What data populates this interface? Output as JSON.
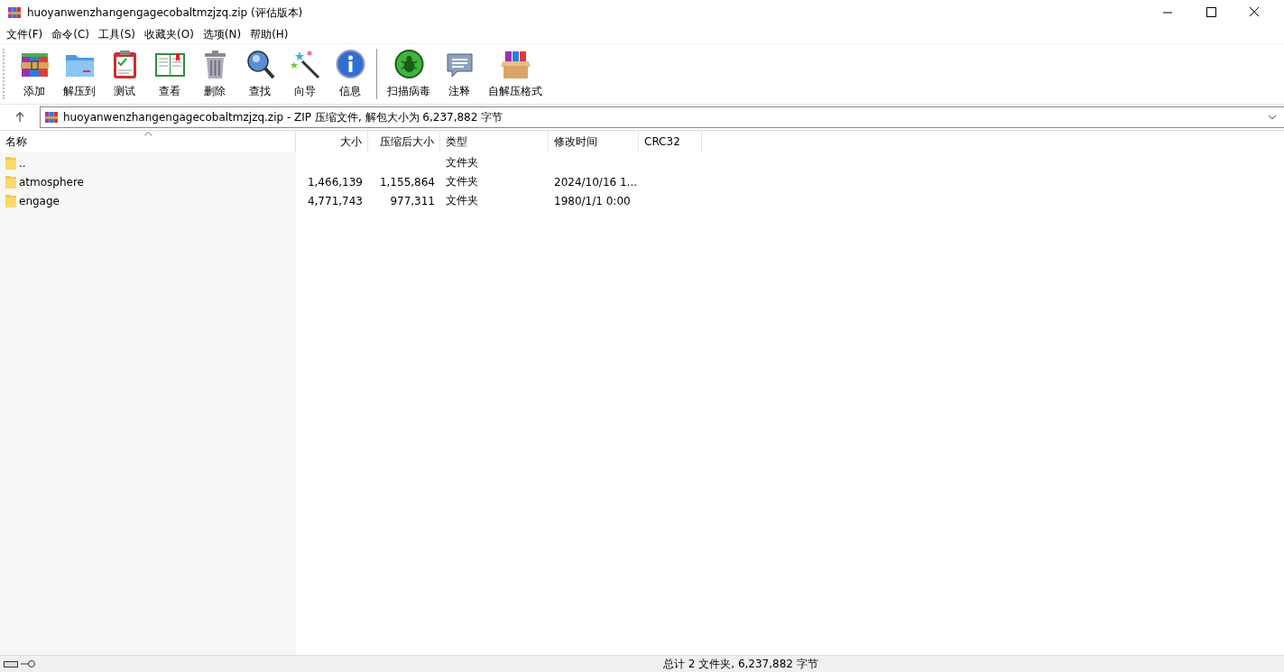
{
  "window": {
    "title": "huoyanwenzhangengagecobaltmzjzq.zip (评估版本)"
  },
  "menu": [
    "文件(F)",
    "命令(C)",
    "工具(S)",
    "收藏夹(O)",
    "选项(N)",
    "帮助(H)"
  ],
  "toolbar": [
    {
      "label": "添加"
    },
    {
      "label": "解压到"
    },
    {
      "label": "测试"
    },
    {
      "label": "查看"
    },
    {
      "label": "删除"
    },
    {
      "label": "查找"
    },
    {
      "label": "向导"
    },
    {
      "label": "信息"
    },
    {
      "label": "扫描病毒"
    },
    {
      "label": "注释"
    },
    {
      "label": "自解压格式"
    }
  ],
  "address": {
    "value": "huoyanwenzhangengagecobaltmzjzq.zip - ZIP 压缩文件, 解包大小为 6,237,882 字节"
  },
  "table": {
    "columns": [
      "名称",
      "大小",
      "压缩后大小",
      "类型",
      "修改时间",
      "CRC32"
    ],
    "rows": [
      {
        "name": "..",
        "size": "",
        "packed": "",
        "type": "文件夹",
        "modified": ""
      },
      {
        "name": "atmosphere",
        "size": "1,466,139",
        "packed": "1,155,864",
        "type": "文件夹",
        "modified": "2024/10/16 1..."
      },
      {
        "name": "engage",
        "size": "4,771,743",
        "packed": "977,311",
        "type": "文件夹",
        "modified": "1980/1/1 0:00"
      }
    ]
  },
  "status_bar": {
    "text": "总计 2 文件夹, 6,237,882 字节"
  }
}
